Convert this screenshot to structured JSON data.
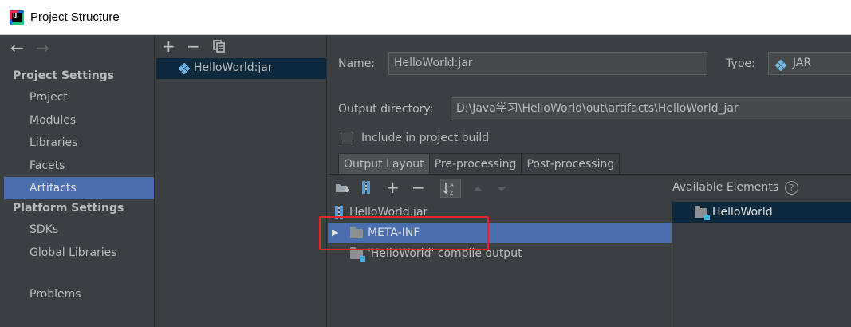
{
  "window": {
    "title": "Project Structure"
  },
  "nav": {
    "back_icon": "←",
    "forward_icon": "→",
    "section_project_settings": "Project Settings",
    "items_project": [
      "Project",
      "Modules",
      "Libraries",
      "Facets",
      "Artifacts"
    ],
    "selected_item": "Artifacts",
    "section_platform_settings": "Platform Settings",
    "items_platform": [
      "SDKs",
      "Global Libraries"
    ],
    "problems": "Problems"
  },
  "artifacts_toolbar": {
    "add": "+",
    "remove": "−",
    "copy_icon": "copy-icon"
  },
  "artifacts_list": [
    "HelloWorld:jar"
  ],
  "details": {
    "name_label": "Name:",
    "name_value": "HelloWorld:jar",
    "type_label": "Type:",
    "type_value": "JAR",
    "output_dir_label": "Output directory:",
    "output_dir_value": "D:\\Java学习\\HelloWorld\\out\\artifacts\\HelloWorld_jar",
    "include_build_label": "Include in project build",
    "include_build_checked": false
  },
  "tabs": [
    "Output Layout",
    "Pre-processing",
    "Post-processing"
  ],
  "active_tab": "Output Layout",
  "layout_toolbar": {
    "add": "+",
    "remove": "−"
  },
  "available_elements_label": "Available Elements",
  "layout_tree": [
    {
      "label": "HelloWorld.jar",
      "kind": "jar"
    },
    {
      "label": "META-INF",
      "kind": "folder",
      "expander": "▶",
      "selected": true,
      "highlighted": true
    },
    {
      "label": "'HelloWorld' compile output",
      "kind": "module-output"
    }
  ],
  "available_elements": [
    {
      "label": "HelloWorld",
      "kind": "module",
      "selected": true
    }
  ],
  "colors": {
    "background": "#3c3f41",
    "selection": "#4b6eaf",
    "selection_inactive": "#0d293e",
    "highlight_box": "#e8222b"
  }
}
